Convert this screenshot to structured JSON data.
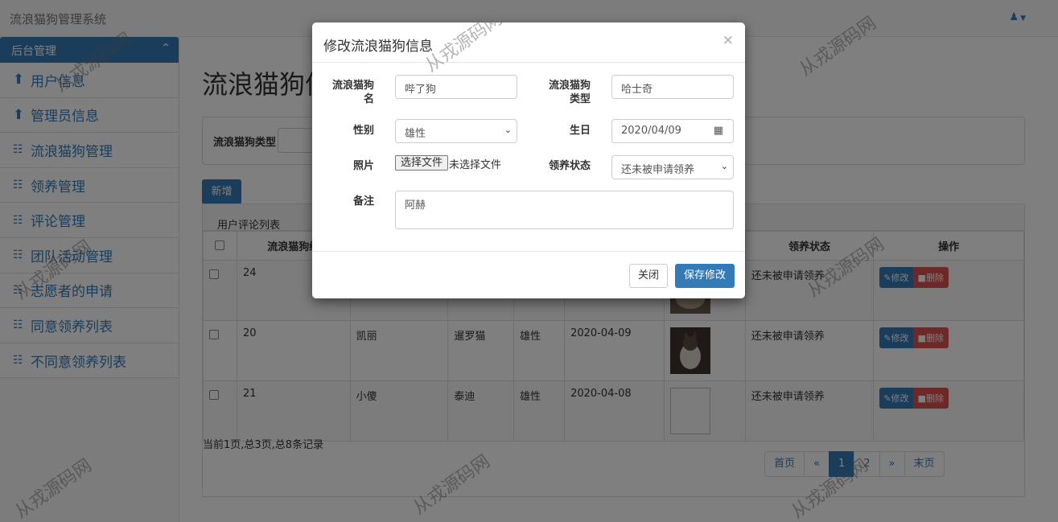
{
  "app": {
    "brand": "流浪猫狗管理系统",
    "user_icon": "user-icon"
  },
  "sidebar": {
    "header": "后台管理",
    "items": [
      {
        "label": "用户信息",
        "icon": "bolt-icon"
      },
      {
        "label": "管理员信息",
        "icon": "bolt-icon"
      },
      {
        "label": "流浪猫狗管理",
        "icon": "sitemap-icon"
      },
      {
        "label": "领养管理",
        "icon": "sitemap-icon"
      },
      {
        "label": "评论管理",
        "icon": "sitemap-icon"
      },
      {
        "label": "团队活动管理",
        "icon": "sitemap-icon"
      },
      {
        "label": "志愿者的申请",
        "icon": "sitemap-icon"
      },
      {
        "label": "同意领养列表",
        "icon": "sitemap-icon"
      },
      {
        "label": "不同意领养列表",
        "icon": "sitemap-icon"
      }
    ]
  },
  "main": {
    "title": "流浪猫狗信",
    "search_label": "流浪猫狗类型",
    "new_button": "新增",
    "panel_heading": "用户评论列表",
    "table": {
      "headers": [
        "",
        "流浪猫狗编",
        "",
        "",
        "",
        "",
        "",
        "领养状态",
        "操作"
      ],
      "rows": [
        {
          "id": "24",
          "name": "",
          "type": "",
          "sex": "",
          "birth": "",
          "status": "还未被申请领养"
        },
        {
          "id": "20",
          "name": "凯丽",
          "type": "暹罗猫",
          "sex": "雄性",
          "birth": "2020-04-09",
          "status": "还未被申请领养"
        },
        {
          "id": "21",
          "name": "小傻",
          "type": "泰迪",
          "sex": "雄性",
          "birth": "2020-04-08",
          "status": "还未被申请领养"
        }
      ],
      "edit_label": "修改",
      "delete_label": "删除"
    },
    "records_text": "当前1页,总3页,总8条记录",
    "pager": [
      "首页",
      "«",
      "1",
      "2",
      "»",
      "末页"
    ]
  },
  "modal": {
    "title": "修改流浪猫狗信息",
    "close_x": "×",
    "fields": {
      "name_label": "流浪猫狗名",
      "name_value": "哔了狗",
      "type_label": "流浪猫狗类型",
      "type_value": "哈士奇",
      "sex_label": "性别",
      "sex_value": "雄性",
      "birth_label": "生日",
      "birth_value": "2020/04/09",
      "photo_label": "照片",
      "file_button": "选择文件",
      "file_text": "未选择文件",
      "status_label": "领养状态",
      "status_value": "还未被申请领养",
      "note_label": "备注",
      "note_value": "阿赫"
    },
    "close_button": "关闭",
    "save_button": "保存修改"
  },
  "watermark": "从戎源码网"
}
